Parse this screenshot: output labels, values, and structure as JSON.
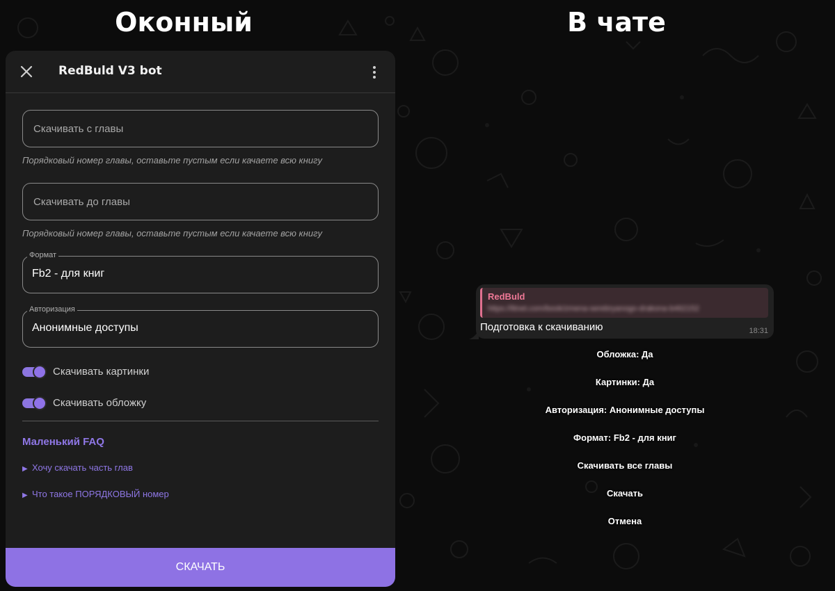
{
  "headings": {
    "left": "Оконный",
    "right": "В чате"
  },
  "window": {
    "title": "RedBuld V3 bot",
    "fields": [
      {
        "placeholder": "Скачивать с главы",
        "hint": "Порядковый номер главы, оставьте пустым если качаете всю книгу"
      },
      {
        "placeholder": "Скачивать до главы",
        "hint": "Порядковый номер главы, оставьте пустым если качаете всю книгу"
      }
    ],
    "selects": [
      {
        "label": "Формат",
        "value": "Fb2 - для книг"
      },
      {
        "label": "Авторизация",
        "value": "Анонимные доступы"
      }
    ],
    "toggles": [
      {
        "label": "Скачивать картинки",
        "on": true
      },
      {
        "label": "Скачивать обложку",
        "on": true
      }
    ],
    "faq": {
      "title": "Маленький FAQ",
      "items": [
        {
          "arrow": "▶",
          "label": "Хочу скачать часть глав"
        },
        {
          "arrow": "▶",
          "label": "Что такое ПОРЯДКОВЫЙ номер"
        }
      ]
    },
    "download_label": "СКАЧАТЬ"
  },
  "chat": {
    "reply_name": "RedBuld",
    "reply_url": "https://litnet.com/book/zmena-serebryanogo-drakona-b462152",
    "message": "Подготовка к скачиванию",
    "time": "18:31",
    "buttons": [
      "Обложка: Да",
      "Картинки: Да",
      "Авторизация: Анонимные доступы",
      "Формат: Fb2 - для книг",
      "Скачивать все главы",
      "Скачать",
      "Отмена"
    ]
  },
  "colors": {
    "accent": "#8e72e4",
    "panel_bg": "#1d1d1d",
    "reply_accent": "#e0708f",
    "page_bg": "#0c0c0c"
  },
  "icons": {
    "close": "close-icon",
    "more": "more-vertical-icon",
    "faq_arrow": "triangle-right-icon"
  }
}
